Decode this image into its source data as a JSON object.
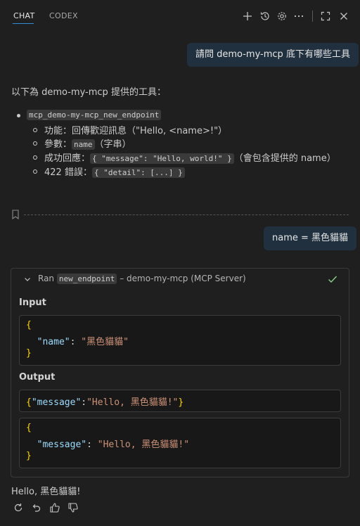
{
  "header": {
    "tabs": [
      {
        "label": "CHAT",
        "active": true
      },
      {
        "label": "CODEX",
        "active": false
      }
    ],
    "icons": [
      "plus-icon",
      "history-icon",
      "gear-icon",
      "more-icon",
      "maximize-icon",
      "close-icon"
    ]
  },
  "messages": {
    "user1": "請問 demo-my-mcp 底下有哪些工具",
    "assistant_intro": "以下為 demo-my-mcp 提供的工具：",
    "tool_name": "mcp_demo-my-mcp_new_endpoint",
    "details": [
      {
        "prefix": "功能：",
        "text": "回傳歡迎訊息（\"Hello, <name>!\"）"
      },
      {
        "prefix": "參數：",
        "code": "name",
        "suffix": "（字串）"
      },
      {
        "prefix": "成功回應：",
        "code": "{ \"message\": \"Hello, world!\" }",
        "suffix": "（會包含提供的 name）"
      },
      {
        "prefix": "422 錯誤：",
        "code": "{ \"detail\": [...] }",
        "suffix": ""
      }
    ],
    "user2": "name = 黑色貓貓"
  },
  "tool_call": {
    "ran_label": "Ran",
    "endpoint": "new_endpoint",
    "server_label": "– demo-my-mcp (MCP Server)",
    "input_label": "Input",
    "input_key": "\"name\"",
    "input_value": "\"黑色貓貓\"",
    "output_label": "Output",
    "output_raw_key": "\"message\"",
    "output_raw_value": "\"Hello, 黑色貓貓!\"",
    "output_key": "\"message\"",
    "output_value": "\"Hello, 黑色貓貓!\""
  },
  "response": "Hello, 黑色貓貓!",
  "footer_icons": [
    "retry-icon",
    "undo-icon",
    "thumbs-up-icon",
    "thumbs-down-icon"
  ],
  "colors": {
    "background": "#1f1f1f",
    "bubble": "#20303f",
    "accent": "#2f8dd6",
    "check": "#89d185",
    "json_key": "#9cdcfe",
    "json_string": "#ce9178",
    "json_brace": "#ffd700"
  }
}
